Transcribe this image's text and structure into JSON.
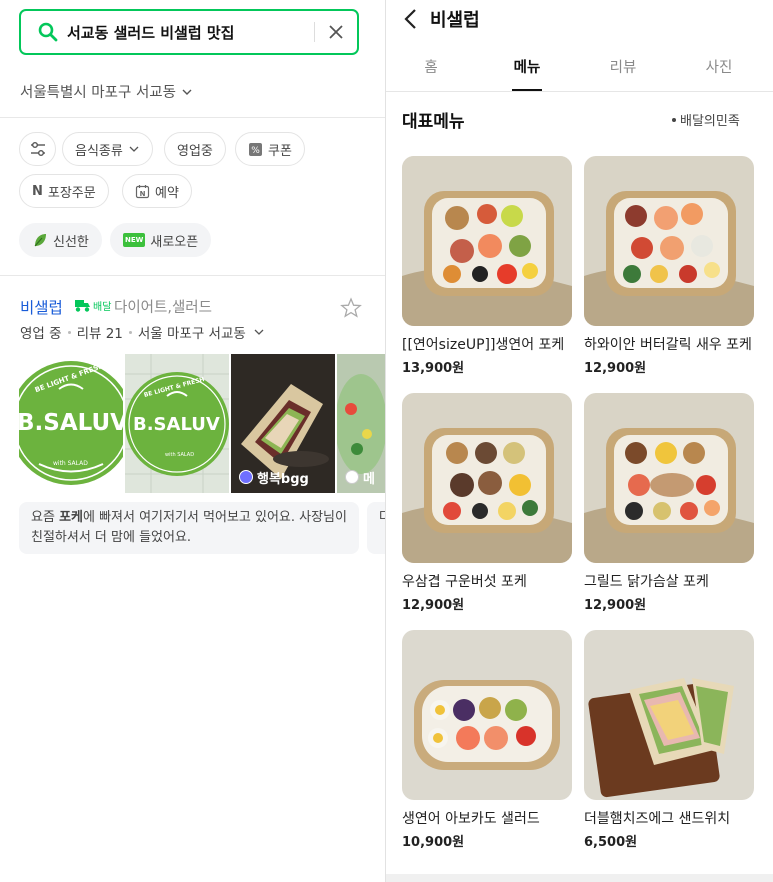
{
  "search": {
    "query": "서교동 샐러드 비샐럽 맛집"
  },
  "location": {
    "label": "서울특별시 마포구 서교동"
  },
  "filters": {
    "row1": [
      {
        "label": ""
      },
      {
        "label": "음식종류"
      },
      {
        "label": "영업중"
      },
      {
        "label": "쿠폰"
      }
    ],
    "row2": [
      {
        "label": "포장주문"
      },
      {
        "label": "예약"
      }
    ],
    "row3": [
      {
        "label": "신선한"
      },
      {
        "label": "새로오픈"
      }
    ],
    "new_badge": "NEW",
    "n_badge": "N"
  },
  "place": {
    "name": "비샐럽",
    "delivery_badge": "배달",
    "category": "다이어트,샐러드",
    "status": "영업 중",
    "reviews": "리뷰 21",
    "address": "서울 마포구 서교동",
    "thumbnails": [
      {
        "logo_top": "BE LIGHT & FRESH",
        "logo_main": "B.SALUV",
        "logo_sub": "with SALAD"
      },
      {
        "logo_top": "BE LIGHT & FRESH",
        "logo_main": "B.SALUV",
        "logo_sub": "with SALAD"
      },
      {
        "user": "행복bgg"
      },
      {
        "user": "메"
      }
    ],
    "reviews_preview": [
      {
        "text_before": "요즘 ",
        "highlight": "포케",
        "text_after": "에 빠져서 여기저기서 먹어보고 있어요. 사장님이 친절하셔서 더 맘에 들었어요."
      },
      {
        "text": "다"
      }
    ]
  },
  "detail": {
    "title": "비샐럽",
    "tabs": [
      {
        "label": "홈"
      },
      {
        "label": "메뉴"
      },
      {
        "label": "리뷰"
      },
      {
        "label": "사진"
      }
    ],
    "active_tab": "메뉴",
    "section_title": "대표메뉴",
    "section_side": "배달의민족",
    "menu": [
      {
        "name": "[[연어sizeUP]]생연어 포케",
        "price": "13,900원",
        "kind": "salmon"
      },
      {
        "name": "하와이안 버터갈릭 새우 포케",
        "price": "12,900원",
        "kind": "shrimp"
      },
      {
        "name": "우삼겹 구운버섯 포케",
        "price": "12,900원",
        "kind": "beef"
      },
      {
        "name": "그릴드 닭가슴살 포케",
        "price": "12,900원",
        "kind": "chicken"
      },
      {
        "name": "생연어 아보카도 샐러드",
        "price": "10,900원",
        "kind": "avocado"
      },
      {
        "name": "더블햄치즈에그 샌드위치",
        "price": "6,500원",
        "kind": "sandwich"
      }
    ]
  },
  "colors": {
    "naver_green": "#03c75a",
    "place_link": "#1a5cd8",
    "logo_green": "#6cb33e"
  }
}
